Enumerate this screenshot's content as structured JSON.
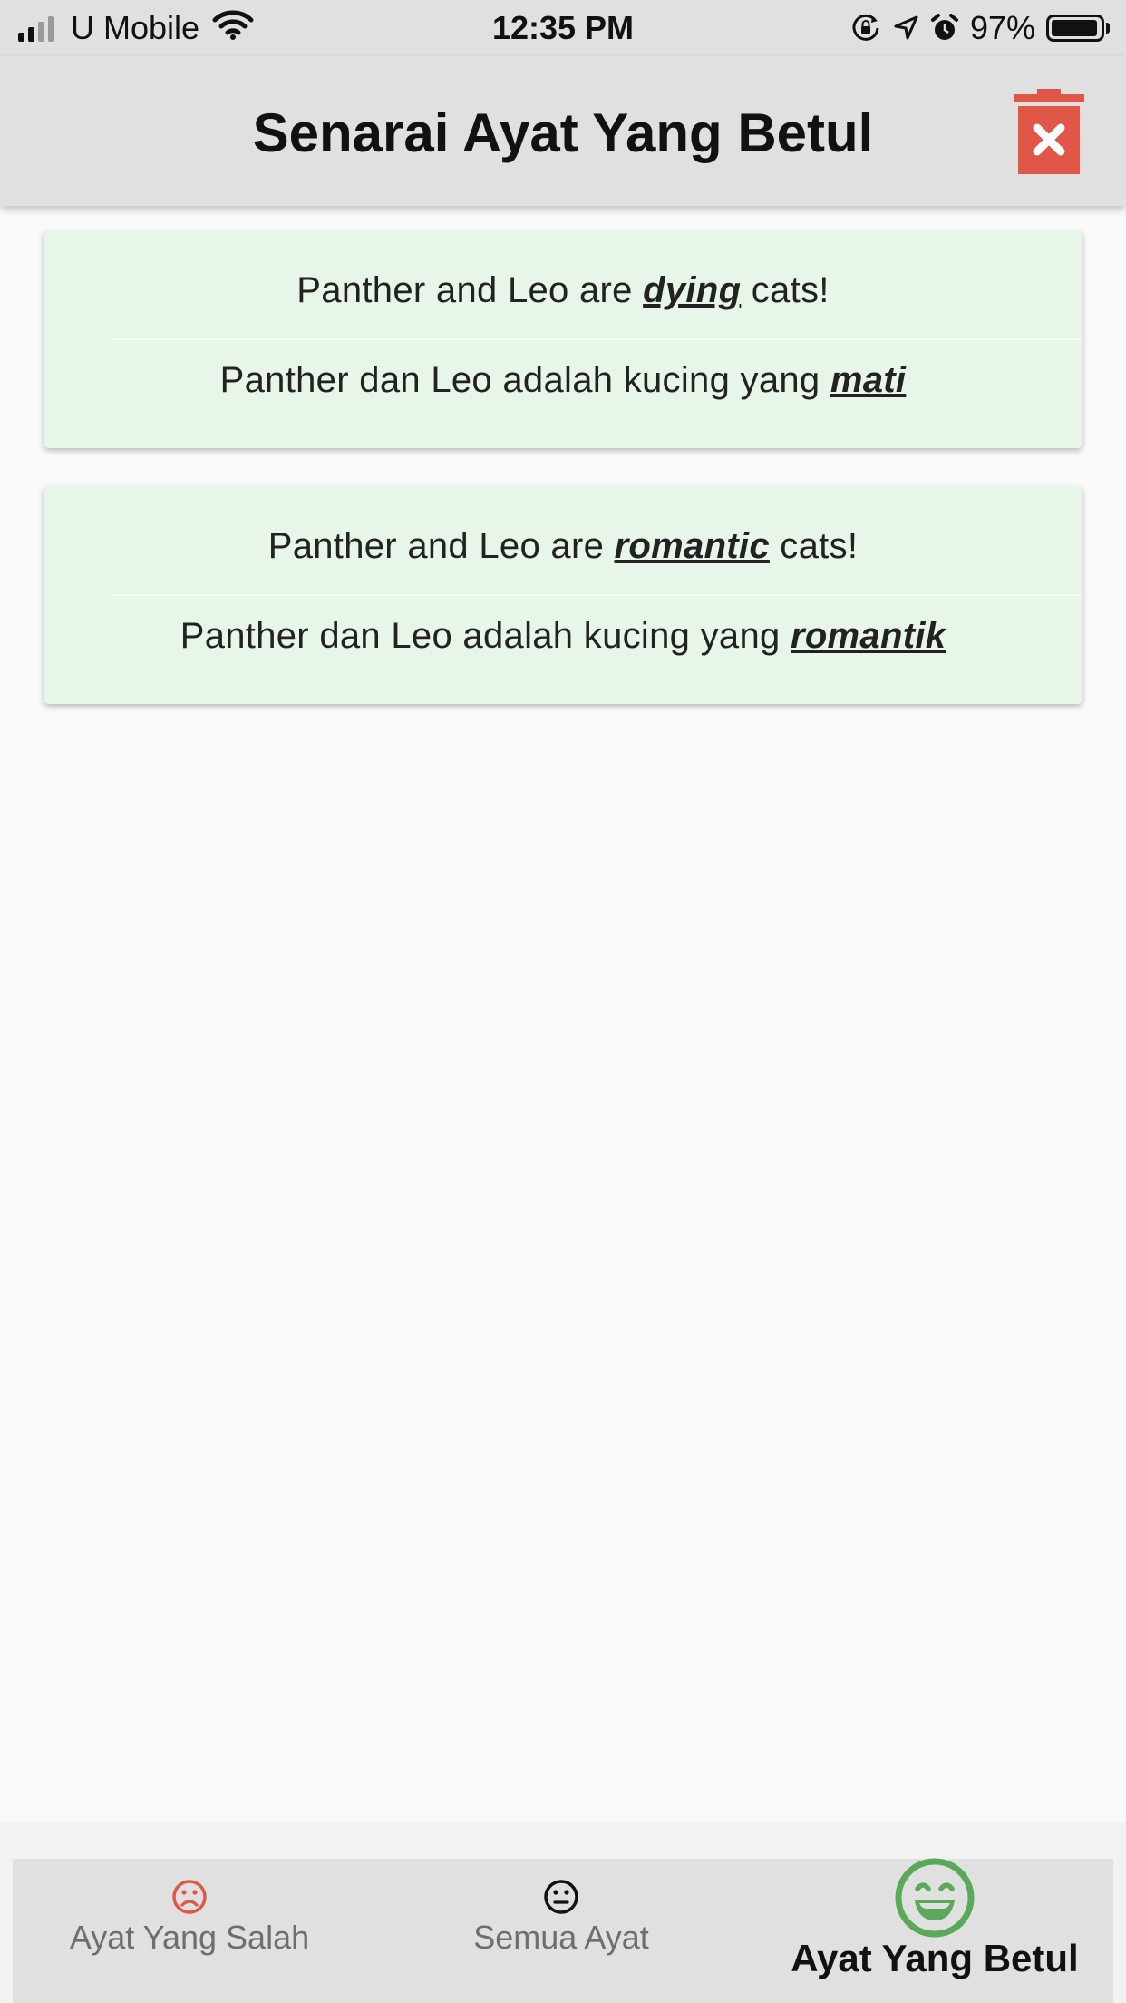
{
  "status_bar": {
    "carrier": "U Mobile",
    "time": "12:35 PM",
    "battery_percent": "97%",
    "battery_level": 0.97,
    "icons": [
      "signal-icon",
      "wifi-icon",
      "orientation-lock-icon",
      "location-icon",
      "alarm-icon",
      "battery-icon"
    ]
  },
  "app_bar": {
    "title": "Senarai Ayat Yang Betul",
    "action_icon": "delete-icon",
    "accent_color": "#e05747"
  },
  "sentences": [
    {
      "en_prefix": "Panther and Leo are ",
      "en_highlight": "dying",
      "en_suffix": " cats!",
      "ms_prefix": "Panther dan Leo adalah kucing yang ",
      "ms_highlight": "mati"
    },
    {
      "en_prefix": "Panther and Leo are ",
      "en_highlight": "romantic",
      "en_suffix": " cats!",
      "ms_prefix": "Panther dan Leo adalah kucing yang ",
      "ms_highlight": "romantik"
    }
  ],
  "card_color": "#e8f5e9",
  "bottom_nav": {
    "items": [
      {
        "label": "Ayat Yang Salah",
        "icon": "sad-face-icon",
        "color": "#e05747",
        "selected": false
      },
      {
        "label": "Semua Ayat",
        "icon": "neutral-face-icon",
        "color": "#111111",
        "selected": false
      },
      {
        "label": "Ayat Yang Betul",
        "icon": "happy-face-icon",
        "color": "#5aa859",
        "selected": true
      }
    ]
  }
}
